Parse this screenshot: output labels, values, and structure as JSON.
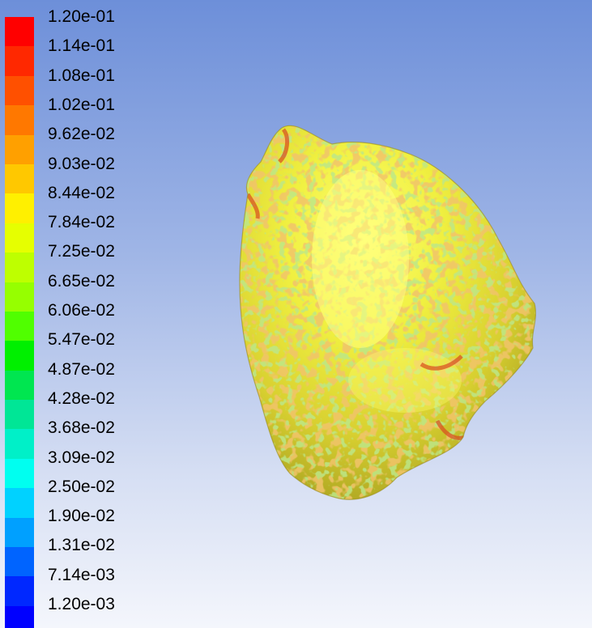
{
  "legend": {
    "labels": [
      "1.20e-01",
      "1.14e-01",
      "1.08e-01",
      "1.02e-01",
      "9.62e-02",
      "9.03e-02",
      "8.44e-02",
      "7.84e-02",
      "7.25e-02",
      "6.65e-02",
      "6.06e-02",
      "5.47e-02",
      "4.87e-02",
      "4.28e-02",
      "3.68e-02",
      "3.09e-02",
      "2.50e-02",
      "1.90e-02",
      "1.31e-02",
      "7.14e-03",
      "1.20e-03"
    ],
    "colors": [
      "#ff0000",
      "#ff2800",
      "#ff5000",
      "#ff7800",
      "#ffa000",
      "#ffc800",
      "#fff000",
      "#e6ff00",
      "#beff00",
      "#96ff00",
      "#50ff00",
      "#00f000",
      "#00e650",
      "#00e696",
      "#00f0c8",
      "#00fff0",
      "#00d2ff",
      "#00a0ff",
      "#0064ff",
      "#0028ff",
      "#0000ff"
    ]
  },
  "background": {
    "top": "#6d8fd9",
    "bottom": "#f4f6fc"
  },
  "surface": {
    "base_color": "#e6e62a",
    "highlight_color": "#ffff70",
    "mottle_orange": "#e6a028",
    "mottle_green": "#8cd23c",
    "mottle_red": "#e05028"
  }
}
